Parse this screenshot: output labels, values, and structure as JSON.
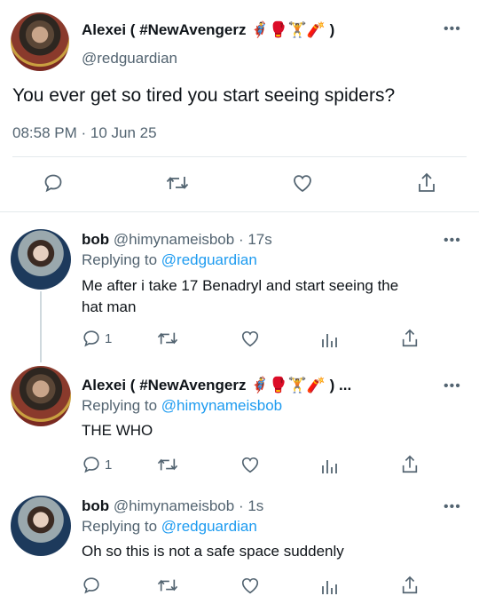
{
  "main_tweet": {
    "display_name": "Alexei ( #NewAvengerz 🦸‍♂️🥊🏋️🧨 )",
    "handle": "@redguardian",
    "text": "You ever get so tired you start seeing spiders?",
    "timestamp": "08:58 PM · 10 Jun 25"
  },
  "replies": [
    {
      "display_name": "bob",
      "handle": "@himynameisbob",
      "time": "· 17s",
      "replying_prefix": "Replying to",
      "replying_to": "@redguardian",
      "text_line1": "Me after i take 17 Benadryl and start seeing the",
      "text_line2": "hat man",
      "reply_count": "1"
    },
    {
      "display_name": "Alexei ( #NewAvengerz 🦸‍♂️🥊🏋️🧨 ) ...",
      "replying_prefix": "Replying to",
      "replying_to": "@himynameisbob",
      "text_line1": "THE WHO",
      "reply_count": "1"
    },
    {
      "display_name": "bob",
      "handle": "@himynameisbob",
      "time": "· 1s",
      "replying_prefix": "Replying to",
      "replying_to": "@redguardian",
      "text_line1": "Oh so this is not a safe space suddenly"
    }
  ],
  "icons": [
    "more-options-icon",
    "reply-icon",
    "retweet-icon",
    "like-icon",
    "share-icon",
    "analytics-icon"
  ],
  "colors": {
    "link": "#1d9bf0",
    "secondary_text": "#536471",
    "divider": "#e4e9ec"
  }
}
